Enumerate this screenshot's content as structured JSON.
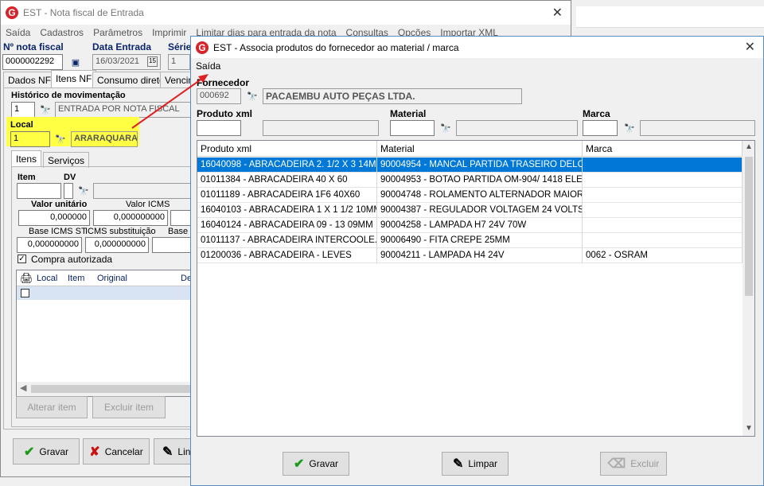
{
  "bg_window": {
    "title": "EST - Nota fiscal de Entrada",
    "menu": [
      "Saída",
      "Cadastros",
      "Parâmetros",
      "Imprimir",
      "Limitar dias para entrada da nota",
      "Consultas",
      "Opções",
      "Importar XML"
    ],
    "nota_label": "Nº nota fiscal",
    "nota_value": "0000002292",
    "data_label": "Data Entrada",
    "data_value": "16/03/2021",
    "serie_label": "Série",
    "serie_value": "1",
    "tabs": [
      "Dados NF",
      "Itens NF",
      "Consumo direto",
      "Vencim"
    ],
    "historico_label": "Histórico de movimentação",
    "historico_code": "1",
    "historico_desc": "ENTRADA POR NOTA FISCAL",
    "local_label": "Local",
    "local_code": "1",
    "local_desc": "ARARAQUARA",
    "subtabs": [
      "Itens",
      "Serviços"
    ],
    "item_label": "Item",
    "dv_label": "DV",
    "valor_unit_label": "Valor unitário",
    "valor_unit_value": "0,000000",
    "valor_icms_label": "Valor ICMS",
    "valor_icms_value": "0,000000000",
    "base_icms_st_label": "Base ICMS ST",
    "base_icms_st_value": "0,000000000",
    "icms_sub_label": "ICMS substituição",
    "icms_sub_value": "0,000000000",
    "base_label": "Base I",
    "compra_label": "Compra autorizada",
    "grid_cols": [
      "Local",
      "Item",
      "Original",
      "De"
    ],
    "alterar_label": "Alterar item",
    "excluir_label": "Excluir item",
    "gravar_label": "Gravar",
    "cancelar_label": "Cancelar",
    "limpar_label": "Lin"
  },
  "dialog": {
    "title": "EST - Associa produtos do fornecedor ao material / marca",
    "menu": [
      "Saída"
    ],
    "fornecedor_label": "Fornecedor",
    "fornecedor_code": "000692",
    "fornecedor_name": "PACAEMBU AUTO PEÇAS LTDA.",
    "produto_label": "Produto xml",
    "material_label": "Material",
    "marca_label": "Marca",
    "columns": [
      "Produto xml",
      "Material",
      "Marca"
    ],
    "rows": [
      {
        "produto": "16040098 - ABRACADEIRA 2. 1/2 X 3 14MM",
        "material": "90004954 - MANCAL PARTIDA TRASEIRO DELC...",
        "marca": ""
      },
      {
        "produto": "01011384 - ABRACADEIRA 40 X 60",
        "material": "90004953 - BOTAO PARTIDA OM-904/ 1418 ELE...",
        "marca": ""
      },
      {
        "produto": "01011189 - ABRACADEIRA 1F6 40X60",
        "material": "90004748 - ROLAMENTO ALTERNADOR MAIOR ...",
        "marca": ""
      },
      {
        "produto": "16040103 - ABRACADEIRA 1 X 1 1/2 10MM",
        "material": "90004387 - REGULADOR VOLTAGEM 24 VOLTS",
        "marca": ""
      },
      {
        "produto": "16040124 - ABRACADEIRA 09 - 13 09MM",
        "material": "90004258 - LAMPADA H7 24V 70W",
        "marca": ""
      },
      {
        "produto": "01011137 - ABRACADEIRA  INTERCOOLE...",
        "material": "90006490 - FITA CREPE 25MM",
        "marca": ""
      },
      {
        "produto": "01200036 - ABRACADEIRA - LEVES",
        "material": "90004211 - LAMPADA H4 24V",
        "marca": "0062 - OSRAM"
      }
    ],
    "gravar_label": "Gravar",
    "limpar_label": "Limpar",
    "excluir_label": "Excluir"
  },
  "colors": {
    "selection": "#0078d7",
    "highlight": "#ffff44",
    "arrow": "#e02020",
    "brand": "#d9232a"
  }
}
